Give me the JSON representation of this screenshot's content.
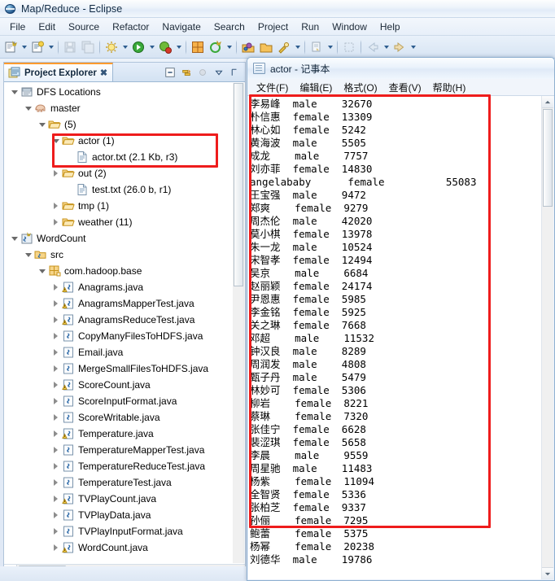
{
  "eclipse": {
    "title": "Map/Reduce - Eclipse",
    "title_icon": "eclipse-globe-icon",
    "menus": [
      "File",
      "Edit",
      "Source",
      "Refactor",
      "Navigate",
      "Search",
      "Project",
      "Run",
      "Window",
      "Help"
    ],
    "toolbar_items": [
      {
        "name": "new-wizard-icon",
        "dropdown": true
      },
      {
        "name": "new-java-class-icon",
        "dropdown": true
      },
      {
        "name": "save-icon",
        "dropdown": false
      },
      {
        "name": "save-all-icon",
        "dropdown": false
      },
      {
        "name": "debug-icon",
        "dropdown": true
      },
      {
        "name": "run-icon",
        "dropdown": true
      },
      {
        "name": "run-external-tools-icon",
        "dropdown": true
      },
      {
        "name": "new-package-icon",
        "dropdown": false
      },
      {
        "name": "new-java-project-icon",
        "dropdown": true
      },
      {
        "name": "open-type-icon",
        "dropdown": false
      },
      {
        "name": "open-task-icon",
        "dropdown": false
      },
      {
        "name": "search-icon",
        "dropdown": true
      },
      {
        "name": "next-annotation-icon",
        "dropdown": true
      },
      {
        "name": "previous-edit-icon",
        "dropdown": false
      },
      {
        "name": "back-icon",
        "dropdown": true
      },
      {
        "name": "forward-icon",
        "dropdown": true
      }
    ]
  },
  "project_explorer": {
    "tab_label": "Project Explorer",
    "tab_icon": "project-explorer-icon",
    "tab_close_icon": "close-icon",
    "view_tools": [
      "collapse-all-icon",
      "link-with-editor-icon",
      "focus-icon",
      "view-menu-icon",
      "minimize-icon"
    ],
    "scroll_thumb_hint": "III",
    "tree": [
      {
        "label": "DFS Locations",
        "indent": 0,
        "twisty": "open",
        "icon": "dfs-locations-icon"
      },
      {
        "label": "master",
        "indent": 1,
        "twisty": "open",
        "icon": "hadoop-elephant-icon"
      },
      {
        "label": "(5)",
        "indent": 2,
        "twisty": "open",
        "icon": "folder-icon"
      },
      {
        "label": "actor (1)",
        "indent": 3,
        "twisty": "open",
        "icon": "folder-icon"
      },
      {
        "label": "actor.txt (2.1 Kb, r3)",
        "indent": 4,
        "twisty": "none",
        "icon": "file-icon"
      },
      {
        "label": "out (2)",
        "indent": 3,
        "twisty": "closed",
        "icon": "folder-icon"
      },
      {
        "label": "test.txt (26.0 b, r1)",
        "indent": 4,
        "twisty": "none",
        "icon": "file-icon"
      },
      {
        "label": "tmp (1)",
        "indent": 3,
        "twisty": "closed",
        "icon": "folder-icon"
      },
      {
        "label": "weather (11)",
        "indent": 3,
        "twisty": "closed",
        "icon": "folder-icon"
      },
      {
        "label": "WordCount",
        "indent": 0,
        "twisty": "open",
        "icon": "java-project-icon"
      },
      {
        "label": "src",
        "indent": 1,
        "twisty": "open",
        "icon": "source-folder-icon"
      },
      {
        "label": "com.hadoop.base",
        "indent": 2,
        "twisty": "open",
        "icon": "package-icon"
      },
      {
        "label": "Anagrams.java",
        "indent": 3,
        "twisty": "closed",
        "icon": "java-class-warning-icon"
      },
      {
        "label": "AnagramsMapperTest.java",
        "indent": 3,
        "twisty": "closed",
        "icon": "java-class-warning-icon"
      },
      {
        "label": "AnagramsReduceTest.java",
        "indent": 3,
        "twisty": "closed",
        "icon": "java-class-warning-icon"
      },
      {
        "label": "CopyManyFilesToHDFS.java",
        "indent": 3,
        "twisty": "closed",
        "icon": "java-class-icon"
      },
      {
        "label": "Email.java",
        "indent": 3,
        "twisty": "closed",
        "icon": "java-class-icon"
      },
      {
        "label": "MergeSmallFilesToHDFS.java",
        "indent": 3,
        "twisty": "closed",
        "icon": "java-class-icon"
      },
      {
        "label": "ScoreCount.java",
        "indent": 3,
        "twisty": "closed",
        "icon": "java-class-warning-icon"
      },
      {
        "label": "ScoreInputFormat.java",
        "indent": 3,
        "twisty": "closed",
        "icon": "java-class-icon"
      },
      {
        "label": "ScoreWritable.java",
        "indent": 3,
        "twisty": "closed",
        "icon": "java-class-icon"
      },
      {
        "label": "Temperature.java",
        "indent": 3,
        "twisty": "closed",
        "icon": "java-class-warning-icon"
      },
      {
        "label": "TemperatureMapperTest.java",
        "indent": 3,
        "twisty": "closed",
        "icon": "java-class-icon"
      },
      {
        "label": "TemperatureReduceTest.java",
        "indent": 3,
        "twisty": "closed",
        "icon": "java-class-icon"
      },
      {
        "label": "TemperatureTest.java",
        "indent": 3,
        "twisty": "closed",
        "icon": "java-class-icon"
      },
      {
        "label": "TVPlayCount.java",
        "indent": 3,
        "twisty": "closed",
        "icon": "java-class-warning-icon"
      },
      {
        "label": "TVPlayData.java",
        "indent": 3,
        "twisty": "closed",
        "icon": "java-class-icon"
      },
      {
        "label": "TVPlayInputFormat.java",
        "indent": 3,
        "twisty": "closed",
        "icon": "java-class-icon"
      },
      {
        "label": "WordCount.java",
        "indent": 3,
        "twisty": "closed",
        "icon": "java-class-warning-icon"
      }
    ]
  },
  "notepad": {
    "title": "actor - 记事本",
    "icon": "notepad-icon",
    "menus": [
      "文件(F)",
      "编辑(E)",
      "格式(O)",
      "查看(V)",
      "帮助(H)"
    ],
    "rows": [
      {
        "name": "李易峰",
        "sex": "male",
        "plays": "32670",
        "wide": false
      },
      {
        "name": "朴信惠",
        "sex": "female",
        "plays": "13309",
        "wide": false
      },
      {
        "name": "林心如",
        "sex": "female",
        "plays": "5242",
        "wide": false
      },
      {
        "name": "黄海波",
        "sex": "male",
        "plays": "5505",
        "wide": false
      },
      {
        "name": "成龙",
        "sex": "male",
        "plays": "7757",
        "wide": false
      },
      {
        "name": "刘亦菲",
        "sex": "female",
        "plays": "14830",
        "wide": false
      },
      {
        "name": "angelababy",
        "sex": "female",
        "plays": "55083",
        "wide": true
      },
      {
        "name": "王宝强",
        "sex": "male",
        "plays": "9472",
        "wide": false
      },
      {
        "name": "郑爽",
        "sex": "female",
        "plays": "9279",
        "wide": false
      },
      {
        "name": "周杰伦",
        "sex": "male",
        "plays": "42020",
        "wide": false
      },
      {
        "name": "莫小棋",
        "sex": "female",
        "plays": "13978",
        "wide": false
      },
      {
        "name": "朱一龙",
        "sex": "male",
        "plays": "10524",
        "wide": false
      },
      {
        "name": "宋智孝",
        "sex": "female",
        "plays": "12494",
        "wide": false
      },
      {
        "name": "吴京",
        "sex": "male",
        "plays": "6684",
        "wide": false
      },
      {
        "name": "赵丽颖",
        "sex": "female",
        "plays": "24174",
        "wide": false
      },
      {
        "name": "尹恩惠",
        "sex": "female",
        "plays": "5985",
        "wide": false
      },
      {
        "name": "李金铭",
        "sex": "female",
        "plays": "5925",
        "wide": false
      },
      {
        "name": "关之琳",
        "sex": "female",
        "plays": "7668",
        "wide": false
      },
      {
        "name": "邓超",
        "sex": "male",
        "plays": "11532",
        "wide": false
      },
      {
        "name": "钟汉良",
        "sex": "male",
        "plays": "8289",
        "wide": false
      },
      {
        "name": "周润发",
        "sex": "male",
        "plays": "4808",
        "wide": false
      },
      {
        "name": "甄子丹",
        "sex": "male",
        "plays": "5479",
        "wide": false
      },
      {
        "name": "林妙可",
        "sex": "female",
        "plays": "5306",
        "wide": false
      },
      {
        "name": "柳岩",
        "sex": "female",
        "plays": "8221",
        "wide": false
      },
      {
        "name": "蔡琳",
        "sex": "female",
        "plays": "7320",
        "wide": false
      },
      {
        "name": "张佳宁",
        "sex": "female",
        "plays": "6628",
        "wide": false
      },
      {
        "name": "裴涩琪",
        "sex": "female",
        "plays": "5658",
        "wide": false
      },
      {
        "name": "李晨",
        "sex": "male",
        "plays": "9559",
        "wide": false
      },
      {
        "name": "周星驰",
        "sex": "male",
        "plays": "11483",
        "wide": false
      },
      {
        "name": "杨紫",
        "sex": "female",
        "plays": "11094",
        "wide": false
      },
      {
        "name": "全智贤",
        "sex": "female",
        "plays": "5336",
        "wide": false
      },
      {
        "name": "张柏芝",
        "sex": "female",
        "plays": "9337",
        "wide": false
      },
      {
        "name": "孙俪",
        "sex": "female",
        "plays": "7295",
        "wide": false
      },
      {
        "name": "鲍蕾",
        "sex": "female",
        "plays": "5375",
        "wide": false
      },
      {
        "name": "杨幂",
        "sex": "female",
        "plays": "20238",
        "wide": false
      },
      {
        "name": "刘德华",
        "sex": "male",
        "plays": "19786",
        "wide": false
      }
    ]
  },
  "annotations": {
    "accent_color": "#ee1c1c",
    "boxes": [
      "actor-folder-highlight",
      "actor-text-highlight"
    ]
  }
}
